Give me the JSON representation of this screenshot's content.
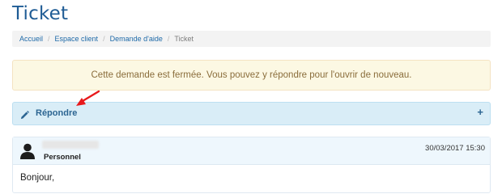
{
  "page": {
    "title": "Ticket"
  },
  "breadcrumb": {
    "items": [
      {
        "label": "Accueil"
      },
      {
        "label": "Espace client"
      },
      {
        "label": "Demande d'aide"
      }
    ],
    "current": "Ticket",
    "separator": "/"
  },
  "alert": {
    "text": "Cette demande est fermée. Vous pouvez y répondre pour l'ouvrir de nouveau."
  },
  "reply_panel": {
    "label": "Répondre",
    "expand_symbol": "+"
  },
  "message": {
    "author_role": "Personnel",
    "date": "30/03/2017 15:30",
    "body": "Bonjour,"
  },
  "icons": {
    "pencil": "pencil-icon",
    "user": "user-icon",
    "expand": "plus-icon",
    "annotation": "red-arrow-icon"
  },
  "colors": {
    "title": "#1f5c95",
    "link": "#1f6aa8",
    "alert_bg": "#fcf8e3",
    "alert_text": "#8a6d3b",
    "panel_bg": "#d9edf7",
    "panel_text": "#2c6592",
    "annotation_arrow": "#e8191b"
  }
}
